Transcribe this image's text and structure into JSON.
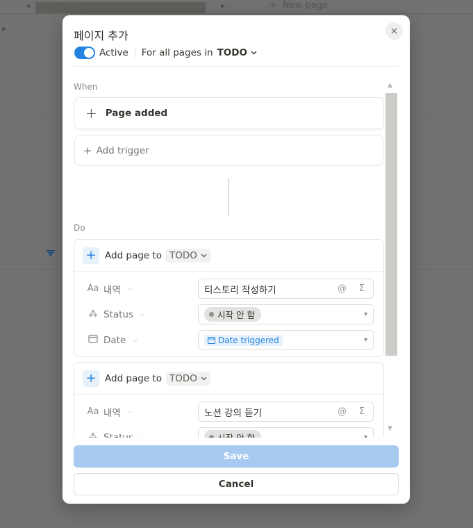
{
  "background": {
    "new_page_label": "New page",
    "plus_glyph": "+"
  },
  "modal": {
    "title": "페이지 추가",
    "close_glyph": "×",
    "active_label": "Active",
    "scope_label": "For all pages in",
    "scope_db": "TODO",
    "when_label": "When",
    "trigger": {
      "label": "Page added"
    },
    "add_trigger_label": "Add trigger",
    "do_label": "Do",
    "actions": [
      {
        "label": "Add page to",
        "db": "TODO",
        "props": [
          {
            "icon": "Aa",
            "name": "내역",
            "value": "티스토리 작성하기"
          },
          {
            "icon": "status-icon",
            "name": "Status",
            "value": "시작 안 함"
          },
          {
            "icon": "calendar-icon",
            "name": "Date",
            "value": "Date triggered"
          }
        ]
      },
      {
        "label": "Add page to",
        "db": "TODO",
        "props": [
          {
            "icon": "Aa",
            "name": "내역",
            "value": "노션 강의 듣기"
          },
          {
            "icon": "status-icon",
            "name": "Status",
            "value": "시작 안 함"
          }
        ]
      }
    ],
    "save_label": "Save",
    "cancel_label": "Cancel"
  },
  "colors": {
    "accent": "#2383e2",
    "save_disabled": "#a7cbf0",
    "overlay": "#727272"
  }
}
